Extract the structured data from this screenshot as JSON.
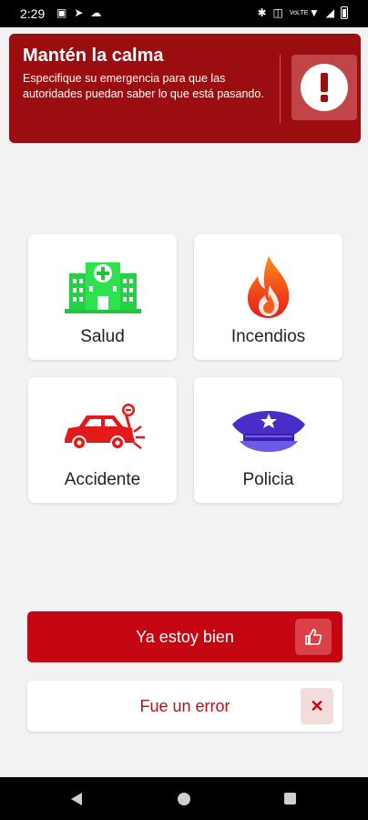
{
  "status_bar": {
    "time": "2:29",
    "left_icons": [
      "gallery-icon",
      "telegram-icon",
      "cloud-icon"
    ],
    "right_icons": [
      "bluetooth-icon",
      "vibrate-icon",
      "volte-icon",
      "wifi-icon",
      "signal-icon",
      "battery-icon"
    ],
    "volte_label": "VoLTE"
  },
  "banner": {
    "title": "Mantén la calma",
    "description": "Especifique su emergencia para que las autoridades puedan saber lo que está pasando.",
    "alert_icon": "exclamation-icon",
    "color": "#9c0d10"
  },
  "categories": [
    {
      "label": "Salud",
      "icon": "hospital-icon"
    },
    {
      "label": "Incendios",
      "icon": "fire-icon"
    },
    {
      "label": "Accidente",
      "icon": "car-crash-icon"
    },
    {
      "label": "Policia",
      "icon": "police-cap-icon"
    }
  ],
  "actions": {
    "primary_label": "Ya estoy bien",
    "primary_icon": "thumbs-up-icon",
    "primary_color": "#c50511",
    "secondary_label": "Fue un error",
    "secondary_icon": "close-icon"
  },
  "nav": {
    "back": "back-icon",
    "home": "home-icon",
    "recents": "recents-icon"
  }
}
